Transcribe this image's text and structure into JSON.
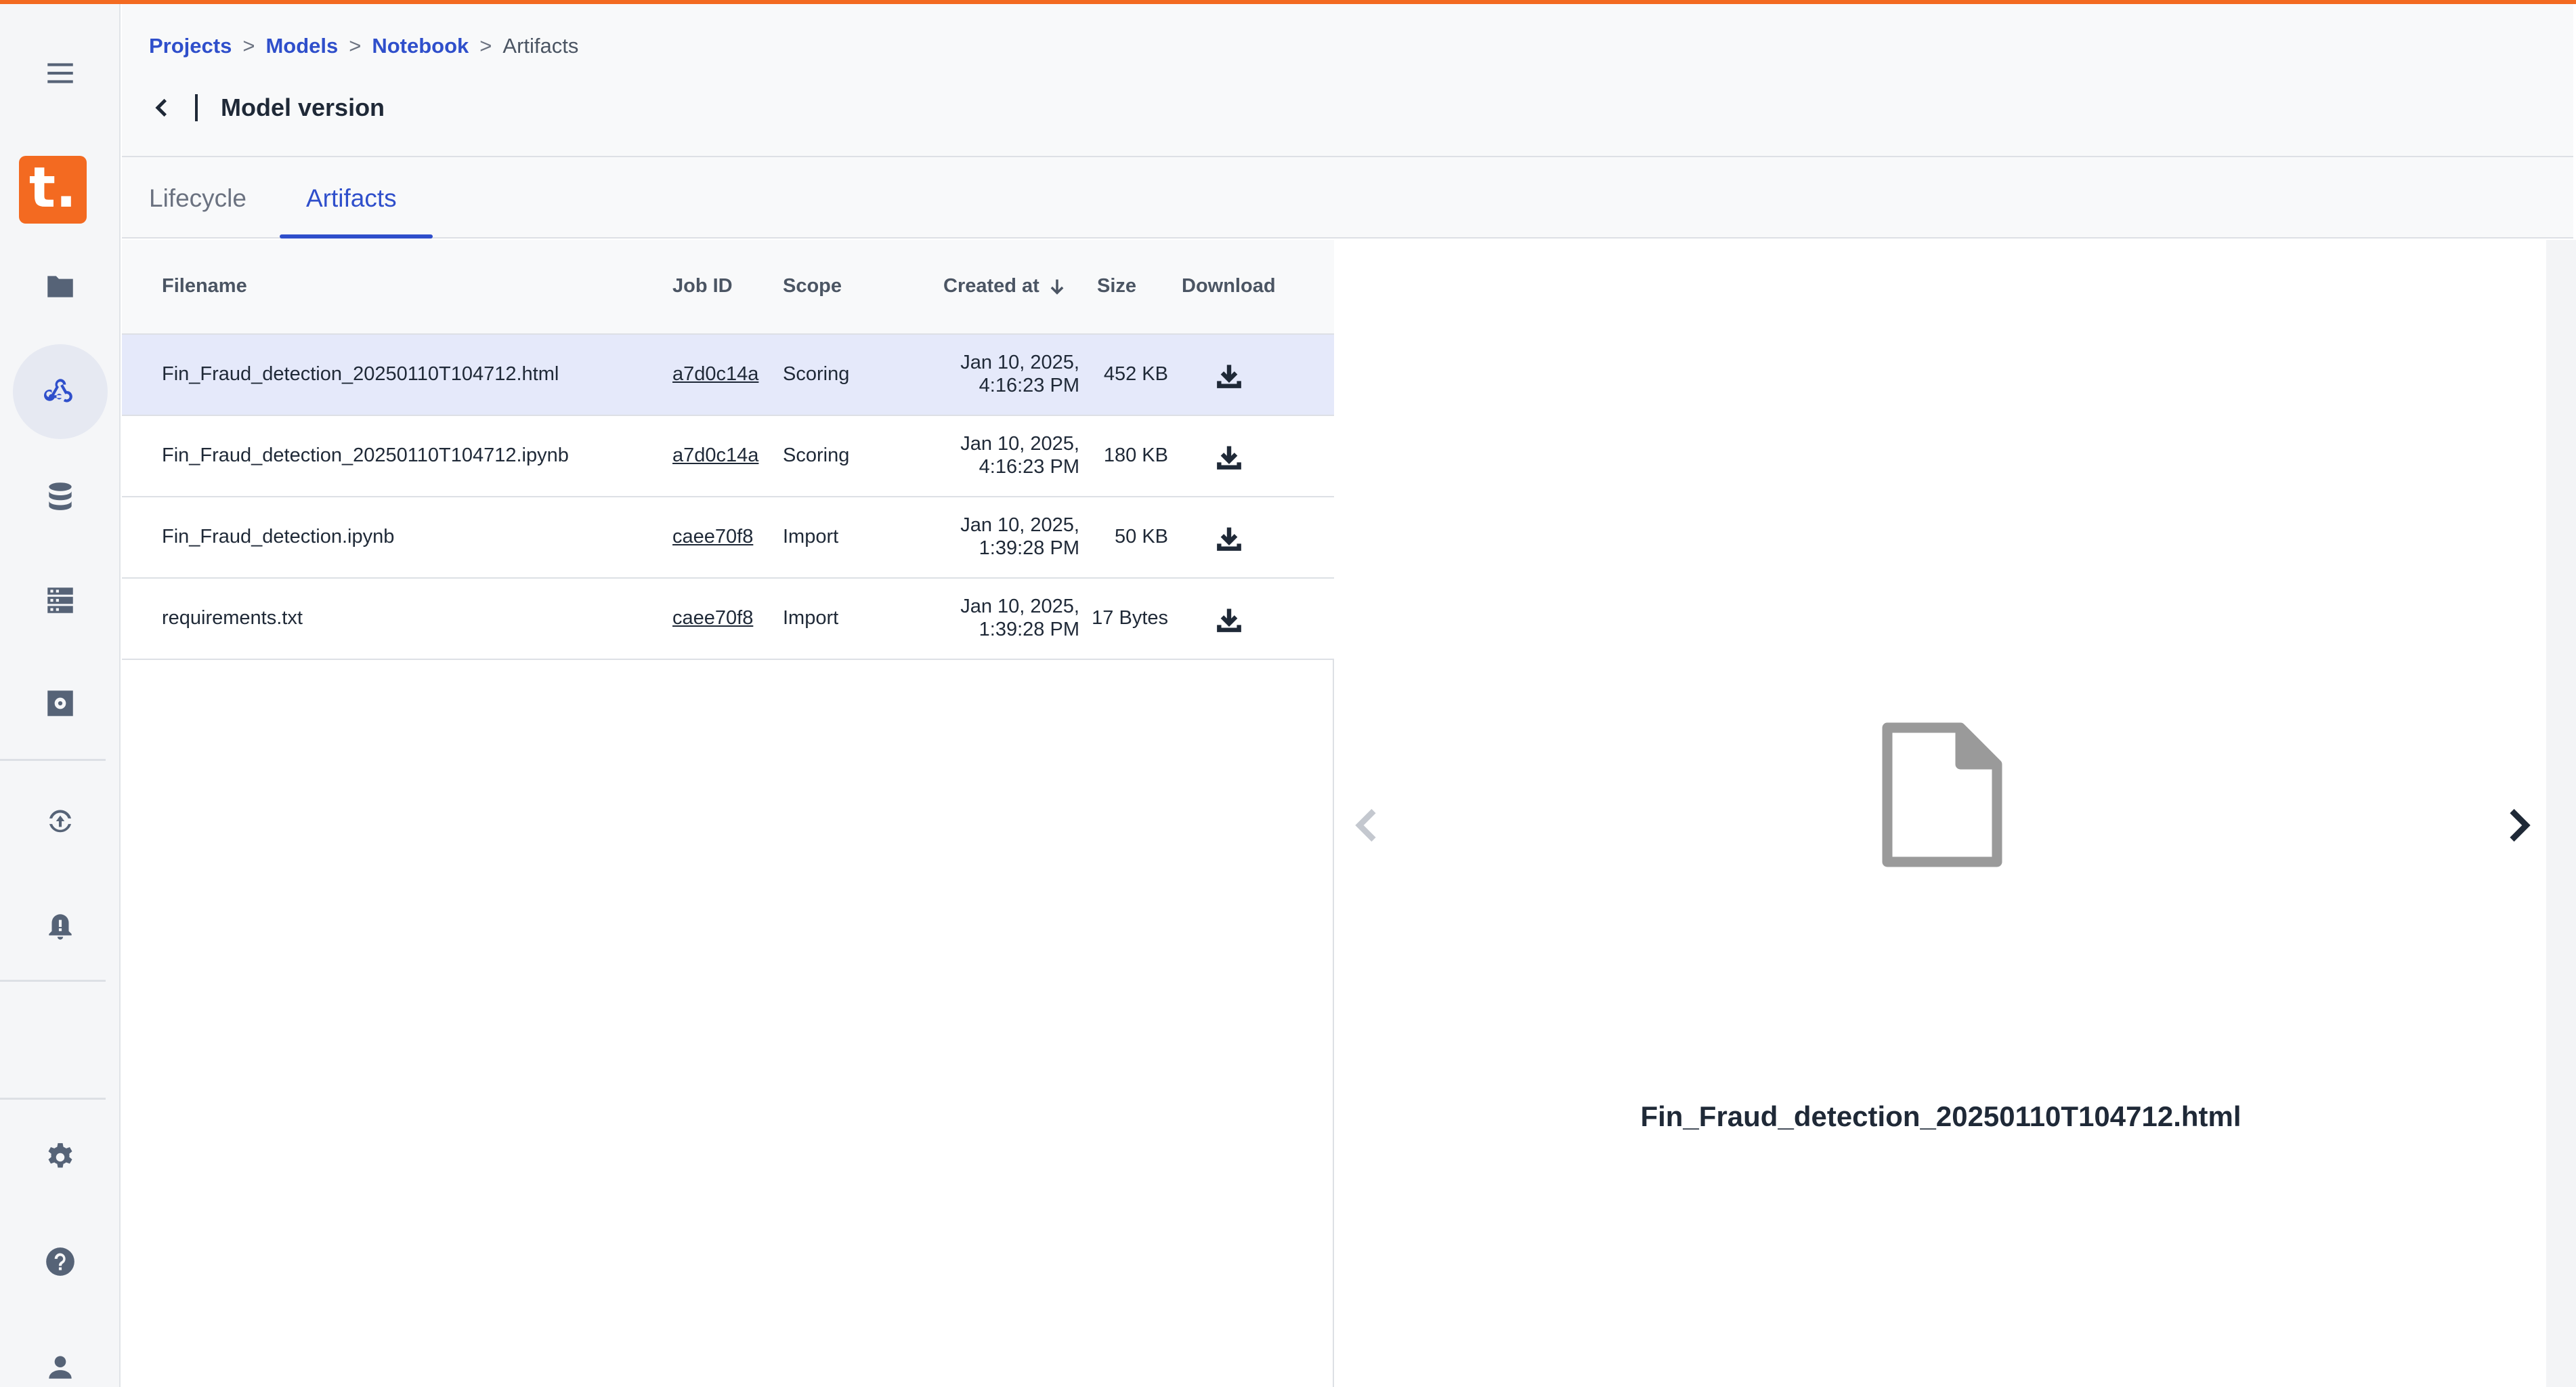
{
  "breadcrumb": {
    "items": [
      "Projects",
      "Models",
      "Notebook"
    ],
    "separator": ">",
    "current": "Artifacts"
  },
  "page": {
    "title": "Model version"
  },
  "tabs": [
    {
      "label": "Lifecycle",
      "active": false
    },
    {
      "label": "Artifacts",
      "active": true
    }
  ],
  "table": {
    "columns": {
      "filename": "Filename",
      "job_id": "Job ID",
      "scope": "Scope",
      "created_at": "Created at",
      "size": "Size",
      "download": "Download"
    },
    "sort": {
      "column": "Created at",
      "direction": "descending"
    },
    "rows": [
      {
        "filename": "Fin_Fraud_detection_20250110T104712.html",
        "job_id": "a7d0c14a",
        "scope": "Scoring",
        "date": "Jan 10, 2025,",
        "time": "4:16:23 PM",
        "size": "452 KB",
        "selected": true
      },
      {
        "filename": "Fin_Fraud_detection_20250110T104712.ipynb",
        "job_id": "a7d0c14a",
        "scope": "Scoring",
        "date": "Jan 10, 2025,",
        "time": "4:16:23 PM",
        "size": "180 KB",
        "selected": false
      },
      {
        "filename": "Fin_Fraud_detection.ipynb",
        "job_id": "caee70f8",
        "scope": "Import",
        "date": "Jan 10, 2025,",
        "time": "1:39:28 PM",
        "size": "50 KB",
        "selected": false
      },
      {
        "filename": "requirements.txt",
        "job_id": "caee70f8",
        "scope": "Import",
        "date": "Jan 10, 2025,",
        "time": "1:39:28 PM",
        "size": "17 Bytes",
        "selected": false
      }
    ]
  },
  "preview": {
    "filename": "Fin_Fraud_detection_20250110T104712.html",
    "icon": "file-icon"
  },
  "sidebar": {
    "logo_text": "t.",
    "items": [
      {
        "icon": "menu-icon",
        "active": false
      },
      {
        "icon": "folder-icon",
        "active": false
      },
      {
        "icon": "webhook-models-icon",
        "active": true
      },
      {
        "icon": "database-icon",
        "active": false
      },
      {
        "icon": "server-icon",
        "active": false
      },
      {
        "icon": "settings-box-icon",
        "active": false
      },
      {
        "icon": "deploy-cycle-icon",
        "active": false
      },
      {
        "icon": "bell-alert-icon",
        "active": false
      },
      {
        "icon": "gear-icon",
        "active": false
      },
      {
        "icon": "help-icon",
        "active": false
      },
      {
        "icon": "user-icon",
        "active": false
      }
    ]
  },
  "colors": {
    "accent": "#f36a21",
    "link": "#2f4fcb",
    "selected_row": "#e5e9fa",
    "sidebar_bg": "#f5f6f8"
  }
}
